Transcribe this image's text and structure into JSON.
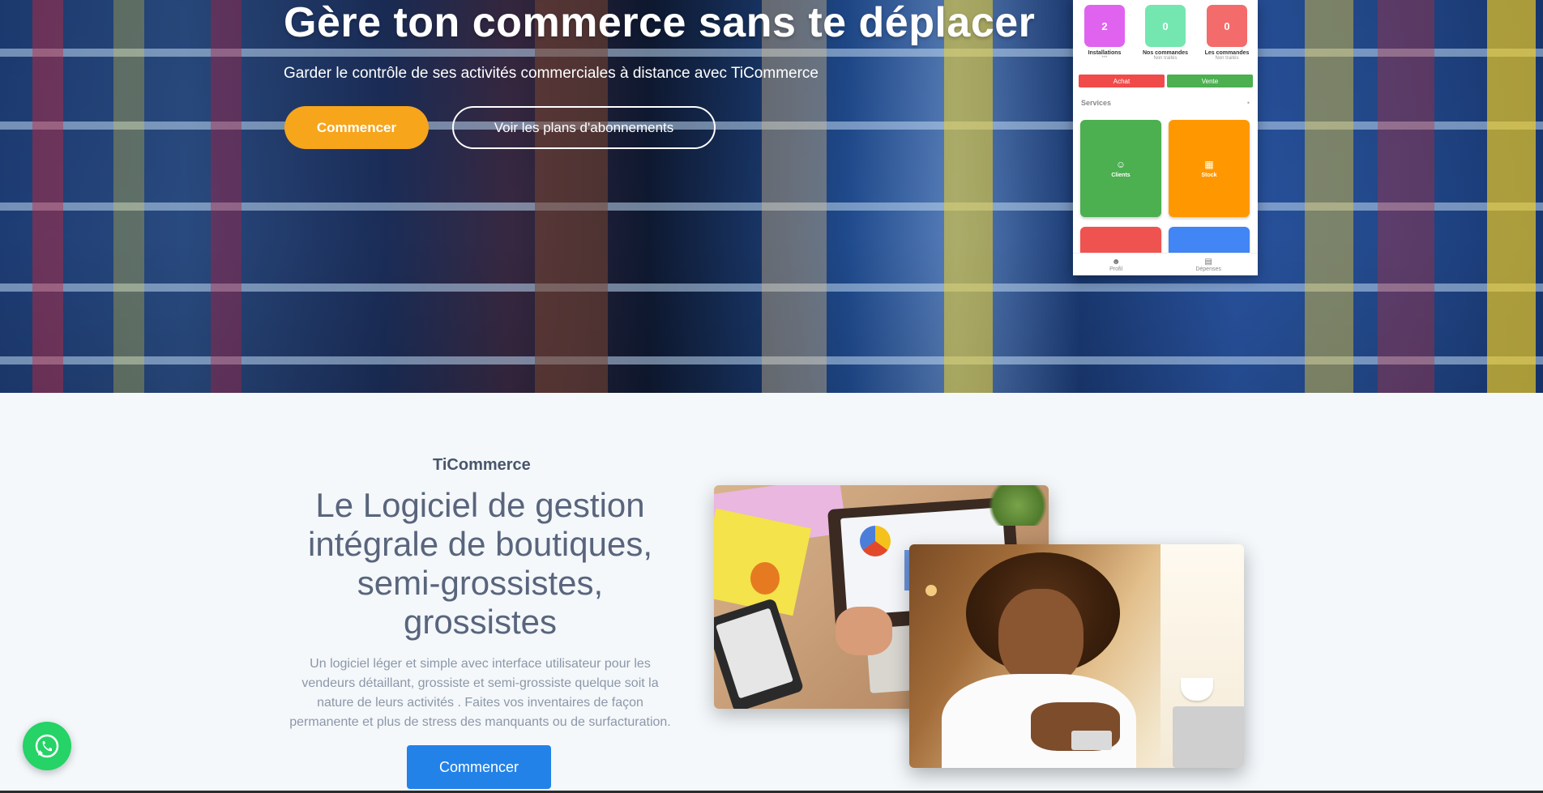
{
  "hero": {
    "title": "Gère ton commerce sans te déplacer",
    "subtitle": "Garder le contrôle de ses activités commerciales à distance avec TiCommerce",
    "cta_primary": "Commencer",
    "cta_secondary": "Voir les plans d'abonnements"
  },
  "phone": {
    "stats": [
      {
        "value": "2",
        "label": "Installations",
        "sub": "***",
        "color": "#e063f0"
      },
      {
        "value": "0",
        "label": "Nos commandes",
        "sub": "Non traités",
        "color": "#74e6b0"
      },
      {
        "value": "0",
        "label": "Les commandes",
        "sub": "Non traités",
        "color": "#f36b6b"
      }
    ],
    "achat_label": "Achat",
    "vente_label": "Vente",
    "services_label": "Services",
    "tiles": [
      {
        "label": "Clients",
        "color": "#4caf50"
      },
      {
        "label": "Stock",
        "color": "#ff9800"
      },
      {
        "label": "",
        "color": "#ef5350"
      },
      {
        "label": "",
        "color": "#4285f4"
      }
    ],
    "nav": [
      {
        "label": "Profil"
      },
      {
        "label": "Dépenses"
      }
    ]
  },
  "main": {
    "eyebrow": "TiCommerce",
    "headline": "Le Logiciel de gestion intégrale de boutiques, semi-grossistes, grossistes",
    "description": "Un logiciel léger et simple avec interface utilisateur pour les vendeurs détaillant, grossiste et semi-grossiste quelque soit la nature de leurs activités . Faites vos inventaires de façon permanente et plus de stress des manquants ou de surfacturation.",
    "cta": "Commencer"
  },
  "colors": {
    "orange": "#f7a51b",
    "blue": "#2382e8",
    "whatsapp": "#25d366"
  }
}
